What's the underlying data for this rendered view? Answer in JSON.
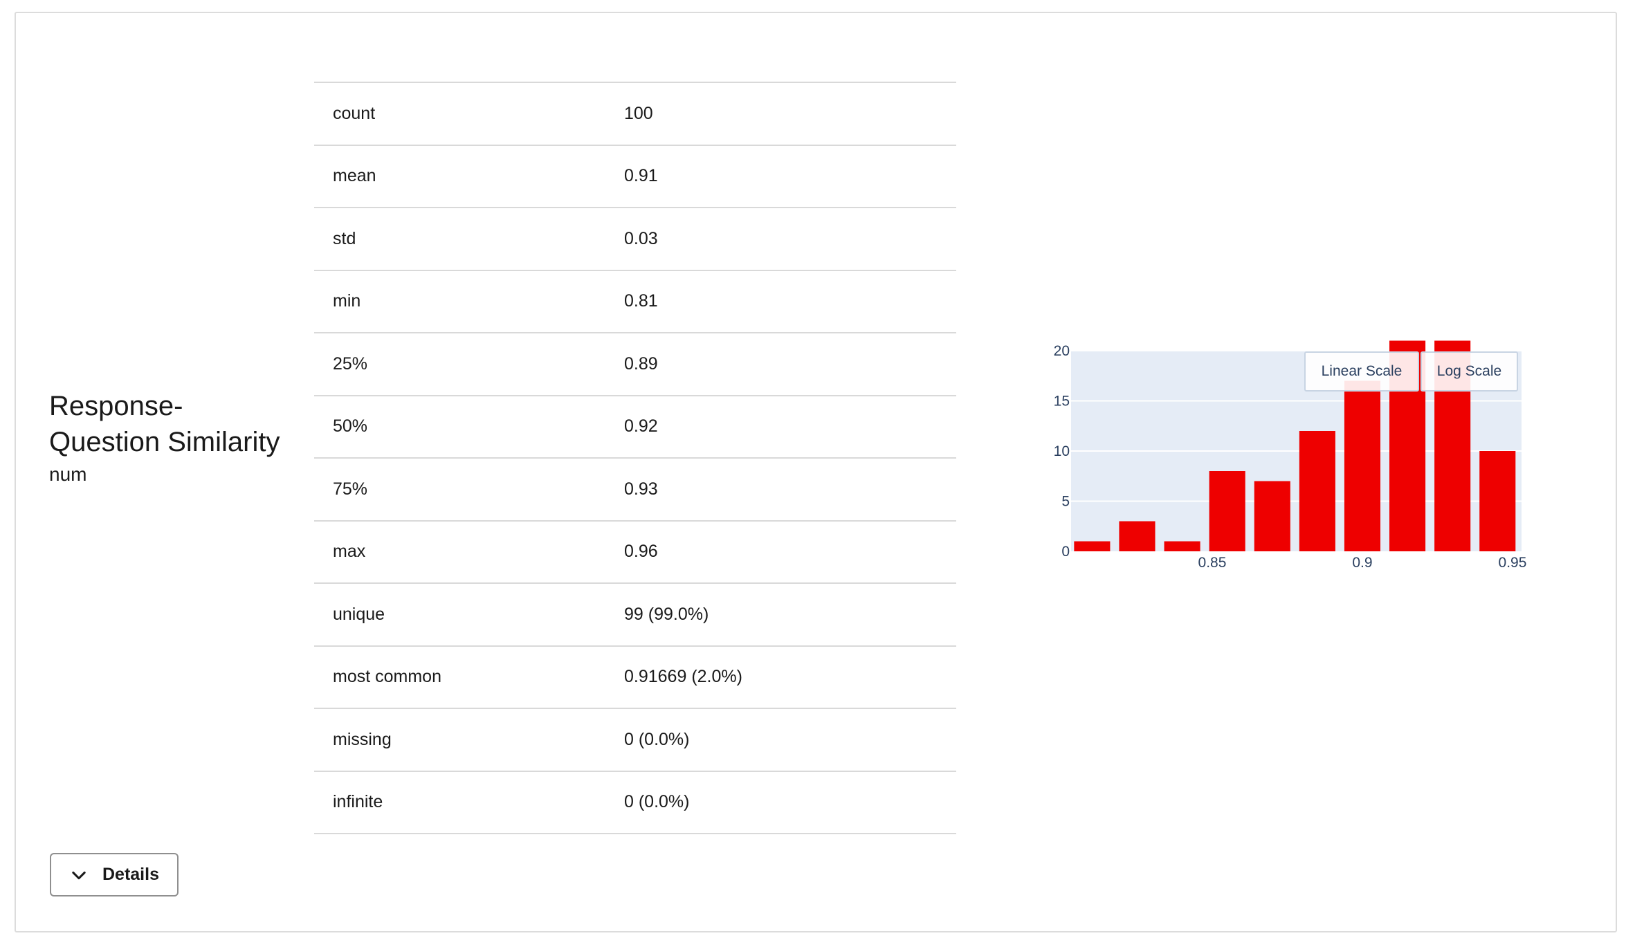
{
  "column": {
    "name": "Response-\nQuestion Similarity",
    "type": "num"
  },
  "details_button": {
    "label": "Details",
    "icon": "chevron-down-icon"
  },
  "stats": [
    {
      "key": "count",
      "value": "100"
    },
    {
      "key": "mean",
      "value": "0.91"
    },
    {
      "key": "std",
      "value": "0.03"
    },
    {
      "key": "min",
      "value": "0.81"
    },
    {
      "key": "25%",
      "value": "0.89"
    },
    {
      "key": "50%",
      "value": "0.92"
    },
    {
      "key": "75%",
      "value": "0.93"
    },
    {
      "key": "max",
      "value": "0.96"
    },
    {
      "key": "unique",
      "value": "99 (99.0%)"
    },
    {
      "key": "most common",
      "value": "0.91669 (2.0%)"
    },
    {
      "key": "missing",
      "value": "0 (0.0%)"
    },
    {
      "key": "infinite",
      "value": "0 (0.0%)"
    }
  ],
  "scale_buttons": {
    "linear": "Linear Scale",
    "log": "Log Scale"
  },
  "chart_data": {
    "type": "bar",
    "x": [
      0.81,
      0.825,
      0.84,
      0.855,
      0.87,
      0.885,
      0.9,
      0.915,
      0.93,
      0.945
    ],
    "values": [
      1,
      3,
      1,
      8,
      7,
      12,
      17,
      21,
      21,
      10
    ],
    "bar_width": 0.012,
    "xlim": [
      0.803,
      0.953
    ],
    "ylim": [
      0,
      20
    ],
    "xticks": [
      0.85,
      0.9,
      0.95
    ],
    "xtick_labels": [
      "0.85",
      "0.9",
      "0.95"
    ],
    "yticks": [
      0,
      5,
      10,
      15,
      20
    ],
    "ytick_labels": [
      "0",
      "5",
      "10",
      "15",
      "20"
    ],
    "colors": {
      "bar": "#ee0000",
      "plot_bg": "#e5ecf6",
      "grid": "#ffffff",
      "tick_text": "#2a3f5f"
    },
    "grid": true,
    "legend": "none"
  }
}
